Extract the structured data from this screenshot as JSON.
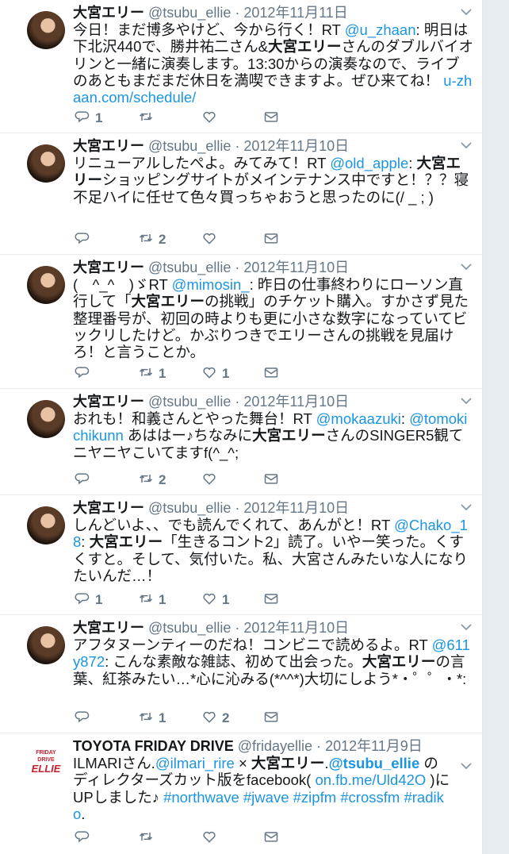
{
  "tweets": [
    {
      "name": "大宮エリー",
      "handle": "@tsubu_ellie",
      "date": "2012年11月11日",
      "text": [
        {
          "t": "今日！まだ博多やけど、今から行く！RT "
        },
        {
          "t": "@u_zhaan",
          "link": true
        },
        {
          "t": ": 明日は下北沢440で、勝井祐二さん&"
        },
        {
          "t": "大宮エリー",
          "bold": true
        },
        {
          "t": "さんのダブルバイオリンと一緒に演奏します。13:30からの演奏なので、ライブのあともまだまだ休日を満喫できますよ。ぜひ来てね！ "
        },
        {
          "t": "u-zhaan.com/schedule/",
          "link": true
        }
      ],
      "replies": "1",
      "retweets": "",
      "likes": ""
    },
    {
      "name": "大宮エリー",
      "handle": "@tsubu_ellie",
      "date": "2012年11月10日",
      "text": [
        {
          "t": "リニューアルしたぺよ。みてみて！RT "
        },
        {
          "t": "@old_apple",
          "link": true
        },
        {
          "t": ": "
        },
        {
          "t": "大宮エリー",
          "bold": true
        },
        {
          "t": "ショッピングサイトがメインテナンス中ですと！？？寝不足ハイに任せて色々買っちゃおうと思ったのに(/ _ ; )"
        }
      ],
      "replies": "",
      "retweets": "2",
      "likes": ""
    },
    {
      "name": "大宮エリー",
      "handle": "@tsubu_ellie",
      "date": "2012年11月10日",
      "text": [
        {
          "t": "(　^_^　)ゞRT "
        },
        {
          "t": "@mimosin_",
          "link": true
        },
        {
          "t": ": 昨日の仕事終わりにローソン直行して「"
        },
        {
          "t": "大宮エリー",
          "bold": true
        },
        {
          "t": "の挑戦」のチケット購入。すかさず見た整理番号が、初回の時よりも更に小さな数字になっていてビックリしたけど。かぶりつきでエリーさんの挑戦を見届けろ！と言うことか。"
        }
      ],
      "replies": "",
      "retweets": "1",
      "likes": "1"
    },
    {
      "name": "大宮エリー",
      "handle": "@tsubu_ellie",
      "date": "2012年11月10日",
      "text": [
        {
          "t": "おれも！和義さんとやった舞台！RT "
        },
        {
          "t": "@mokaazuki",
          "link": true
        },
        {
          "t": ": "
        },
        {
          "t": "@tomokichikunn",
          "link": true
        },
        {
          "t": " あははー♪ちなみに"
        },
        {
          "t": "大宮エリー",
          "bold": true
        },
        {
          "t": "さんのSINGER5観てニヤニヤこいてますf(^_^;"
        }
      ],
      "replies": "",
      "retweets": "2",
      "likes": ""
    },
    {
      "name": "大宮エリー",
      "handle": "@tsubu_ellie",
      "date": "2012年11月10日",
      "text": [
        {
          "t": "しんどいよ、、でも読んでくれて、あんがと！RT "
        },
        {
          "t": "@Chako_18",
          "link": true
        },
        {
          "t": ": "
        },
        {
          "t": "大宮エリー",
          "bold": true
        },
        {
          "t": "「生きるコント2」読了。いやー笑った。くすくすと。そして、気付いた。私、大宮さんみたいな人になりたいんだ…！"
        }
      ],
      "replies": "1",
      "retweets": "1",
      "likes": "1"
    },
    {
      "name": "大宮エリー",
      "handle": "@tsubu_ellie",
      "date": "2012年11月10日",
      "text": [
        {
          "t": "アフタヌーンティーのだね！コンビニで読めるよ。RT "
        },
        {
          "t": "@611y872",
          "link": true
        },
        {
          "t": ": こんな素敵な雑誌、初めて出会った。"
        },
        {
          "t": "大宮エリー",
          "bold": true
        },
        {
          "t": "の言葉、紅茶みたい…*心に沁みる(*^^*)大切にしよう*・゜゜・*:"
        }
      ],
      "replies": "",
      "retweets": "1",
      "likes": "2"
    },
    {
      "name": "TOYOTA FRIDAY DRIVE",
      "handle": "@fridayellie",
      "date": "2012年11月9日",
      "brand": true,
      "logo_line1": "FRIDAY DRIVE",
      "logo_line2": "ELLIE",
      "text": [
        {
          "t": "ILMARIさん."
        },
        {
          "t": "@ilmari_rire",
          "link": true
        },
        {
          "t": " × "
        },
        {
          "t": "大宮エリー",
          "bold": true
        },
        {
          "t": "."
        },
        {
          "t": "@tsubu_ellie",
          "link": true,
          "bold": true
        },
        {
          "t": " のディレクターズカット版をfacebook( "
        },
        {
          "t": "on.fb.me/Uld42O",
          "link": true
        },
        {
          "t": " )にUPしました♪ "
        },
        {
          "t": "#northwave",
          "link": true
        },
        {
          "t": " "
        },
        {
          "t": "#jwave",
          "link": true
        },
        {
          "t": " "
        },
        {
          "t": "#zipfm",
          "link": true
        },
        {
          "t": " "
        },
        {
          "t": "#crossfm",
          "link": true
        },
        {
          "t": " "
        },
        {
          "t": "#radiko",
          "link": true
        },
        {
          "t": "."
        }
      ],
      "replies": "",
      "retweets": "",
      "likes": ""
    }
  ],
  "colors": {
    "link": "#1b95e0",
    "meta": "#657786",
    "text": "#14171a",
    "brand_red": "#cc1f2d"
  },
  "icons": [
    "reply-icon",
    "retweet-icon",
    "like-icon",
    "dm-icon",
    "chevron-down-icon"
  ]
}
